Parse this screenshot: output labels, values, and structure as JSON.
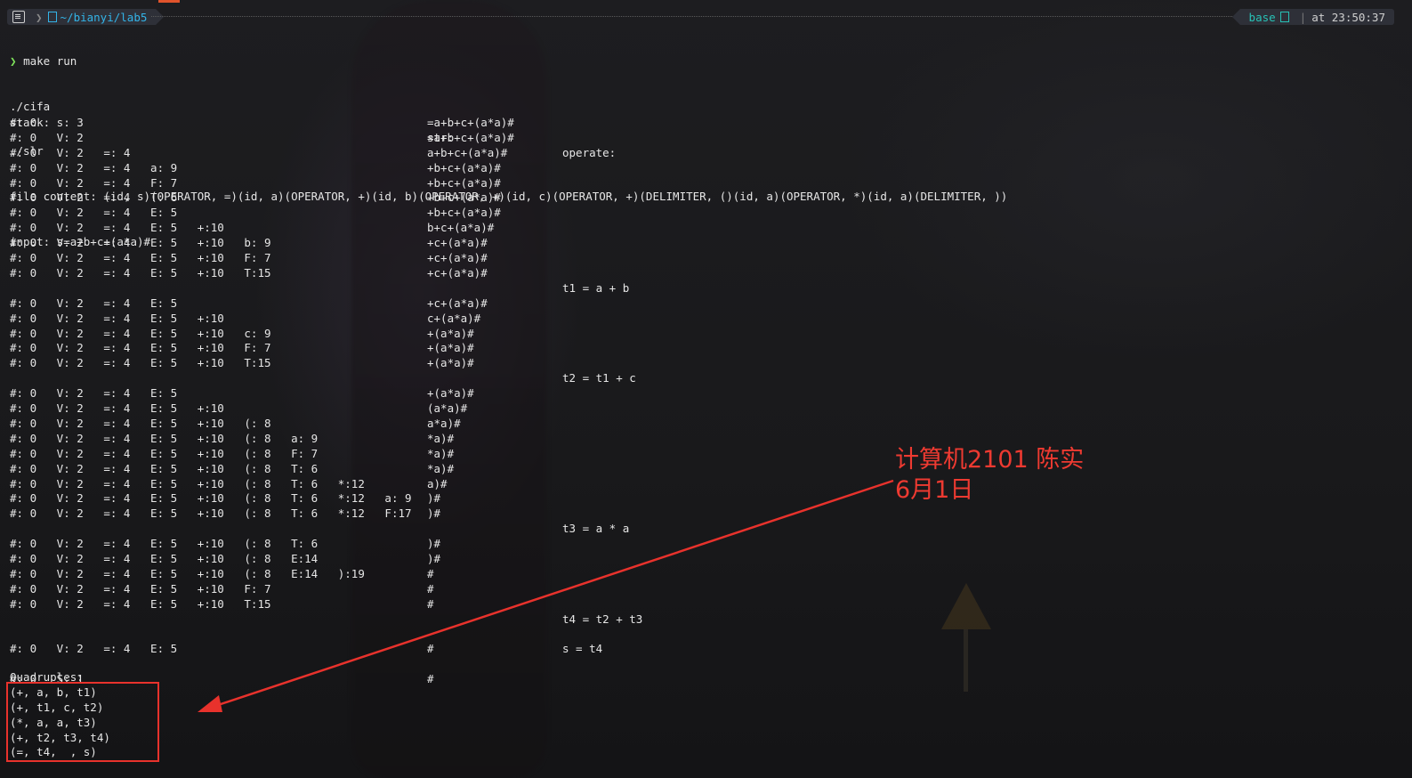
{
  "prompt": {
    "path": "~/bianyi/lab5",
    "env": "base",
    "time_prefix": "at",
    "time": "23:50:37"
  },
  "command": "make run",
  "output_lines": [
    "./cifa",
    "./slr",
    "file content: (id, s)(OPERATOR, =)(id, a)(OPERATOR, +)(id, b)(OPERATOR, +)(id, c)(OPERATOR, +)(DELIMITER, ()(id, a)(OPERATOR, *)(id, a)(DELIMITER, ))",
    "input: s=a+b+c+(a*a)#"
  ],
  "headers": {
    "stack": "stack:",
    "str": "str:",
    "operate": "operate:"
  },
  "rows": [
    {
      "stack": "#: 0   s: 3",
      "str": "=a+b+c+(a*a)#",
      "op": ""
    },
    {
      "stack": "#: 0   V: 2",
      "str": "=a+b+c+(a*a)#",
      "op": ""
    },
    {
      "stack": "#: 0   V: 2   =: 4",
      "str": "a+b+c+(a*a)#",
      "op": ""
    },
    {
      "stack": "#: 0   V: 2   =: 4   a: 9",
      "str": "+b+c+(a*a)#",
      "op": ""
    },
    {
      "stack": "#: 0   V: 2   =: 4   F: 7",
      "str": "+b+c+(a*a)#",
      "op": ""
    },
    {
      "stack": "#: 0   V: 2   =: 4   T: 6",
      "str": "+b+c+(a*a)#",
      "op": ""
    },
    {
      "stack": "#: 0   V: 2   =: 4   E: 5",
      "str": "+b+c+(a*a)#",
      "op": ""
    },
    {
      "stack": "#: 0   V: 2   =: 4   E: 5   +:10",
      "str": "b+c+(a*a)#",
      "op": ""
    },
    {
      "stack": "#: 0   V: 2   =: 4   E: 5   +:10   b: 9",
      "str": "+c+(a*a)#",
      "op": ""
    },
    {
      "stack": "#: 0   V: 2   =: 4   E: 5   +:10   F: 7",
      "str": "+c+(a*a)#",
      "op": ""
    },
    {
      "stack": "#: 0   V: 2   =: 4   E: 5   +:10   T:15",
      "str": "+c+(a*a)#",
      "op": ""
    },
    {
      "stack": "",
      "str": "",
      "op": "t1 = a + b"
    },
    {
      "stack": "#: 0   V: 2   =: 4   E: 5",
      "str": "+c+(a*a)#",
      "op": ""
    },
    {
      "stack": "#: 0   V: 2   =: 4   E: 5   +:10",
      "str": "c+(a*a)#",
      "op": ""
    },
    {
      "stack": "#: 0   V: 2   =: 4   E: 5   +:10   c: 9",
      "str": "+(a*a)#",
      "op": ""
    },
    {
      "stack": "#: 0   V: 2   =: 4   E: 5   +:10   F: 7",
      "str": "+(a*a)#",
      "op": ""
    },
    {
      "stack": "#: 0   V: 2   =: 4   E: 5   +:10   T:15",
      "str": "+(a*a)#",
      "op": ""
    },
    {
      "stack": "",
      "str": "",
      "op": "t2 = t1 + c"
    },
    {
      "stack": "#: 0   V: 2   =: 4   E: 5",
      "str": "+(a*a)#",
      "op": ""
    },
    {
      "stack": "#: 0   V: 2   =: 4   E: 5   +:10",
      "str": "(a*a)#",
      "op": ""
    },
    {
      "stack": "#: 0   V: 2   =: 4   E: 5   +:10   (: 8",
      "str": "a*a)#",
      "op": ""
    },
    {
      "stack": "#: 0   V: 2   =: 4   E: 5   +:10   (: 8   a: 9",
      "str": "*a)#",
      "op": ""
    },
    {
      "stack": "#: 0   V: 2   =: 4   E: 5   +:10   (: 8   F: 7",
      "str": "*a)#",
      "op": ""
    },
    {
      "stack": "#: 0   V: 2   =: 4   E: 5   +:10   (: 8   T: 6",
      "str": "*a)#",
      "op": ""
    },
    {
      "stack": "#: 0   V: 2   =: 4   E: 5   +:10   (: 8   T: 6   *:12",
      "str": "a)#",
      "op": ""
    },
    {
      "stack": "#: 0   V: 2   =: 4   E: 5   +:10   (: 8   T: 6   *:12   a: 9",
      "str": ")#",
      "op": ""
    },
    {
      "stack": "#: 0   V: 2   =: 4   E: 5   +:10   (: 8   T: 6   *:12   F:17",
      "str": ")#",
      "op": ""
    },
    {
      "stack": "",
      "str": "",
      "op": "t3 = a * a"
    },
    {
      "stack": "#: 0   V: 2   =: 4   E: 5   +:10   (: 8   T: 6",
      "str": ")#",
      "op": ""
    },
    {
      "stack": "#: 0   V: 2   =: 4   E: 5   +:10   (: 8   E:14",
      "str": ")#",
      "op": ""
    },
    {
      "stack": "#: 0   V: 2   =: 4   E: 5   +:10   (: 8   E:14   ):19",
      "str": "#",
      "op": ""
    },
    {
      "stack": "#: 0   V: 2   =: 4   E: 5   +:10   F: 7",
      "str": "#",
      "op": ""
    },
    {
      "stack": "#: 0   V: 2   =: 4   E: 5   +:10   T:15",
      "str": "#",
      "op": ""
    },
    {
      "stack": "",
      "str": "",
      "op": "t4 = t2 + t3"
    },
    {
      "stack": "",
      "str": "",
      "op": ""
    },
    {
      "stack": "#: 0   V: 2   =: 4   E: 5",
      "str": "#",
      "op": "s = t4"
    },
    {
      "stack": "",
      "str": "",
      "op": ""
    },
    {
      "stack": "#: 0   S: 1",
      "str": "#",
      "op": ""
    }
  ],
  "quadruples_header": "Quadruples:",
  "quadruples": [
    "(+, a, b, t1)",
    "(+, t1, c, t2)",
    "(*, a, a, t3)",
    "(+, t2, t3, t4)",
    "(=, t4,  , s)"
  ],
  "annotation": {
    "line1": "计算机2101 陈实",
    "line2": "6月1日",
    "color": "#ee3a31"
  },
  "colors": {
    "path": "#33b4e8",
    "env": "#27c2b6",
    "prompt_chevron": "#7ee25b",
    "highlight": "#e8322c"
  }
}
